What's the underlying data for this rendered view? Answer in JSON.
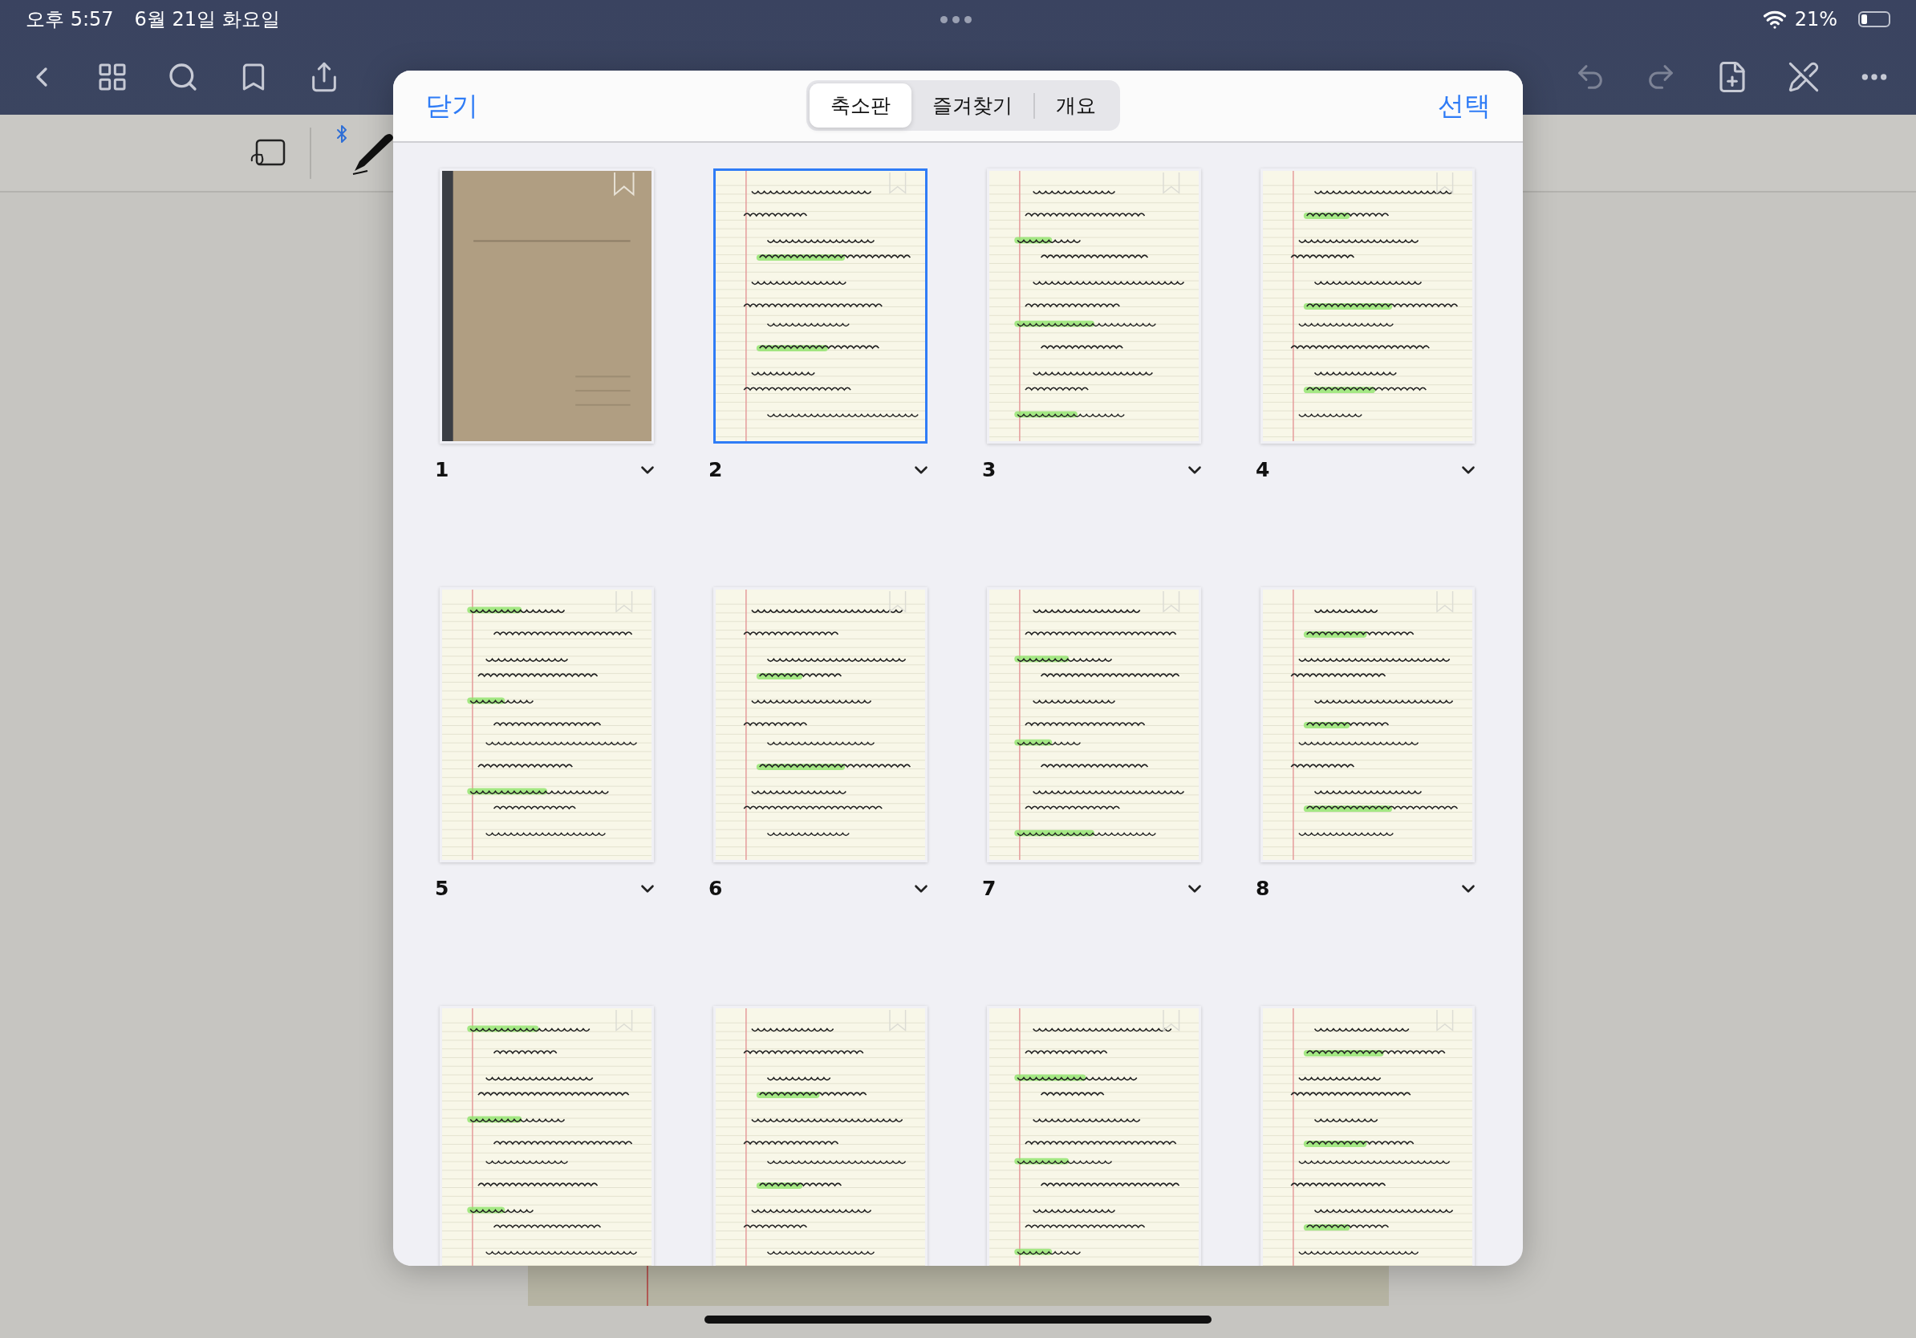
{
  "status_bar": {
    "time": "오후 5:57",
    "date": "6월 21일 화요일",
    "battery": "21%"
  },
  "sheet": {
    "close": "닫기",
    "select": "선택",
    "tabs": [
      {
        "label": "축소판",
        "selected": true
      },
      {
        "label": "즐겨찾기",
        "selected": false
      },
      {
        "label": "개요",
        "selected": false
      }
    ],
    "pages": [
      {
        "number": "1",
        "kind": "cover",
        "selected": false
      },
      {
        "number": "2",
        "kind": "notes",
        "selected": true
      },
      {
        "number": "3",
        "kind": "notes",
        "selected": false
      },
      {
        "number": "4",
        "kind": "notes",
        "selected": false
      },
      {
        "number": "5",
        "kind": "notes",
        "selected": false
      },
      {
        "number": "6",
        "kind": "notes",
        "selected": false
      },
      {
        "number": "7",
        "kind": "notes",
        "selected": false
      },
      {
        "number": "8",
        "kind": "notes",
        "selected": false
      },
      {
        "kind": "notes",
        "selected": false
      },
      {
        "kind": "notes",
        "selected": false
      },
      {
        "kind": "notes",
        "selected": false
      },
      {
        "kind": "notes",
        "selected": false
      }
    ]
  }
}
